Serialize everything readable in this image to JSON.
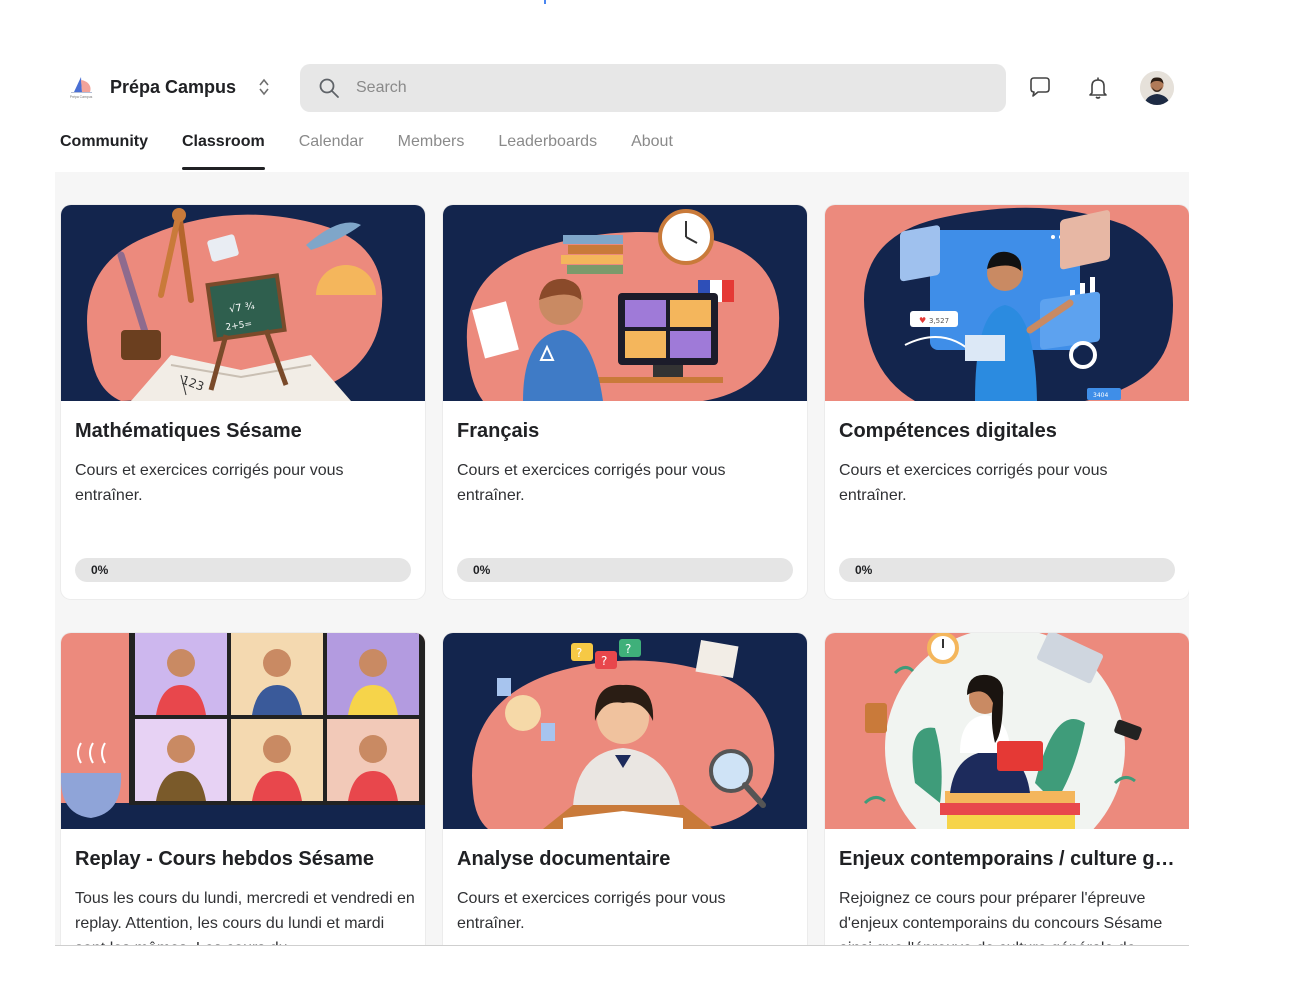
{
  "app": {
    "name": "Prépa Campus",
    "logo_text": "Prépa Campus"
  },
  "search": {
    "placeholder": "Search",
    "value": ""
  },
  "header_icons": [
    "search-icon",
    "chat-icon",
    "bell-icon",
    "avatar"
  ],
  "tabs": [
    {
      "label": "Community",
      "state": "default"
    },
    {
      "label": "Classroom",
      "state": "active"
    },
    {
      "label": "Calendar",
      "state": "default"
    },
    {
      "label": "Members",
      "state": "default"
    },
    {
      "label": "Leaderboards",
      "state": "default"
    },
    {
      "label": "About",
      "state": "default"
    }
  ],
  "courses": [
    {
      "title": "Mathématiques Sésame",
      "description": "Cours et exercices corrigés pour vous entraîner.",
      "progress_label": "0%",
      "progress": 0,
      "illustration": "math-tools-illustration"
    },
    {
      "title": "Français",
      "description": "Cours et exercices corrigés pour vous entraîner.",
      "progress_label": "0%",
      "progress": 0,
      "illustration": "video-class-illustration"
    },
    {
      "title": "Compétences digitales",
      "description": "Cours et exercices corrigés pour vous entraîner.",
      "progress_label": "0%",
      "progress": 0,
      "illustration": "digital-dashboard-illustration",
      "badges": [
        "3,527",
        "3404"
      ]
    },
    {
      "title": "Replay - Cours hebdos Sésame",
      "description": "Tous les cours du lundi, mercredi et vendredi en replay. Attention, les cours du lundi et mardi sont les mêmes. Les cours du",
      "illustration": "video-grid-illustration"
    },
    {
      "title": "Analyse documentaire",
      "description": "Cours et exercices corrigés pour vous entraîner.",
      "illustration": "student-reading-illustration"
    },
    {
      "title": "Enjeux contemporains / culture gé...",
      "description": "Rejoignez ce cours pour préparer l'épreuve d'enjeux contemporains du concours Sésame ainsi que l'épreuve de culture générale de",
      "illustration": "laptop-books-illustration"
    }
  ],
  "colors": {
    "navy": "#13254d",
    "salmon": "#ec8a7d",
    "accent": "#202124",
    "progress_track": "#e5e5e5",
    "search_bg": "#e7e7e7"
  }
}
